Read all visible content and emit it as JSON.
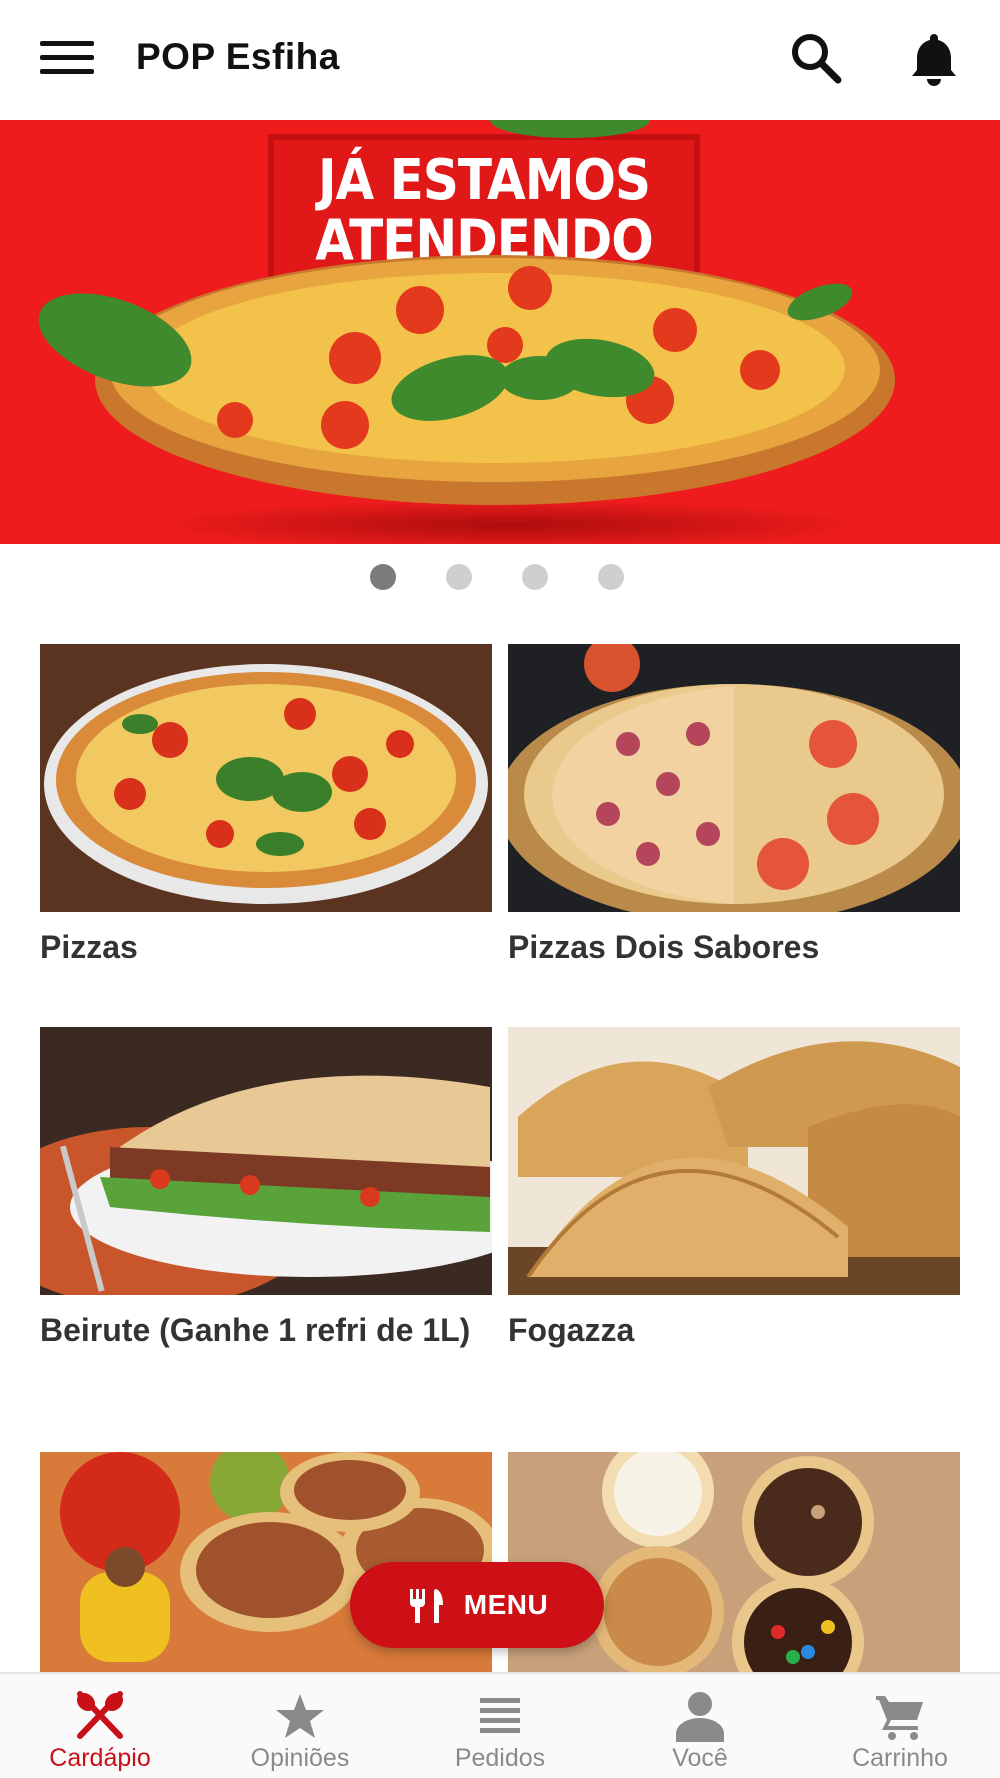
{
  "header": {
    "title": "POP Esfiha",
    "menu_icon": "hamburger-menu-icon",
    "search_icon": "search-icon",
    "notification_icon": "bell-icon"
  },
  "banner": {
    "headline_line1": "JÁ ESTAMOS",
    "headline_line2": "ATENDENDO",
    "background_color": "#ee1c1c"
  },
  "carousel": {
    "slide_count": 4,
    "active_index": 0
  },
  "categories": [
    {
      "label": "Pizzas"
    },
    {
      "label": "Pizzas Dois Sabores"
    },
    {
      "label": "Beirute (Ganhe 1 refri de 1L)"
    },
    {
      "label": "Fogazza"
    },
    {
      "label": ""
    },
    {
      "label": ""
    }
  ],
  "menu_button": {
    "label": "MENU",
    "icon": "fork-knife-icon",
    "color": "#cc1016"
  },
  "bottom_nav": {
    "items": [
      {
        "label": "Cardápio",
        "icon": "utensils-icon",
        "active": true
      },
      {
        "label": "Opiniões",
        "icon": "star-icon",
        "active": false
      },
      {
        "label": "Pedidos",
        "icon": "list-icon",
        "active": false
      },
      {
        "label": "Você",
        "icon": "person-icon",
        "active": false
      },
      {
        "label": "Carrinho",
        "icon": "cart-icon",
        "active": false
      }
    ],
    "active_color": "#c81018",
    "inactive_color": "#8a8a8a"
  }
}
